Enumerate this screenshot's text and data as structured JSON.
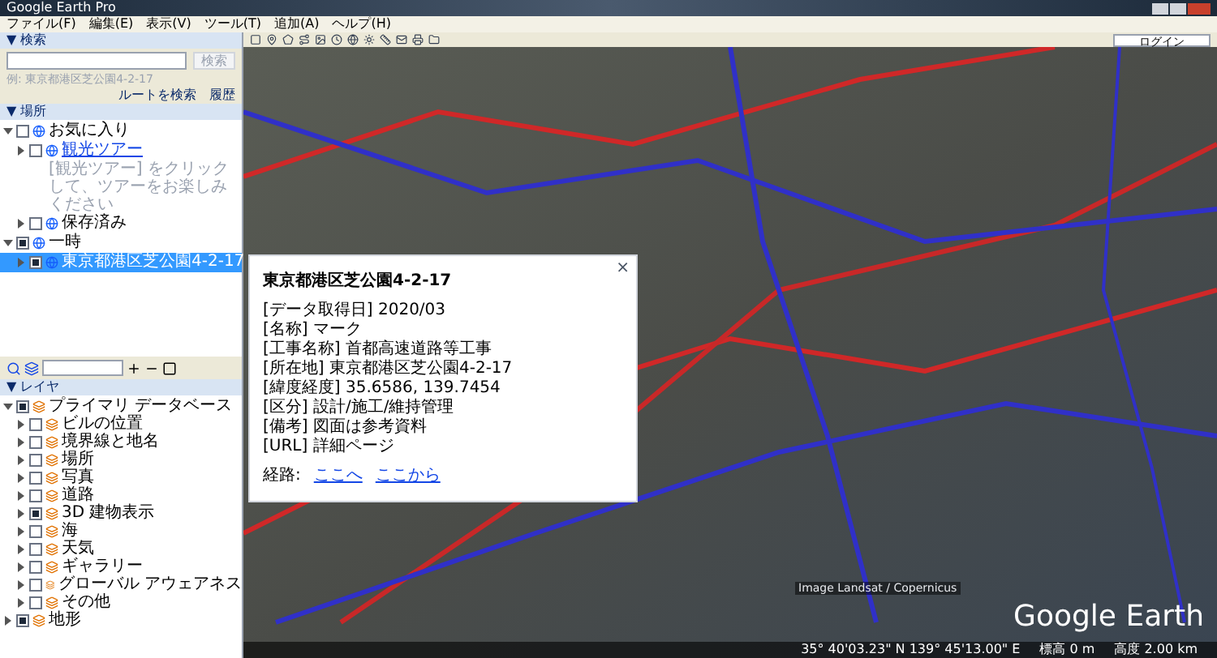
{
  "window": {
    "title": "Google Earth Pro"
  },
  "menu": [
    "ファイル(F)",
    "編集(E)",
    "表示(V)",
    "ツール(T)",
    "追加(A)",
    "ヘルプ(H)"
  ],
  "search": {
    "header": "▼ 検索",
    "button": "検索",
    "hint": "例: 東京都港区芝公園4-2-17",
    "links": [
      "ルートを検索",
      "履歴"
    ]
  },
  "places": {
    "header": "▼ 場所",
    "items": [
      {
        "label": "お気に入り",
        "checked": false,
        "expanded": true,
        "selected": false,
        "children": [
          {
            "label": "観光ツアー",
            "checked": false,
            "expanded": false,
            "selected": false,
            "link": true,
            "description": "[観光ツアー] をクリックして、ツアーをお楽しみください"
          },
          {
            "label": "保存済み",
            "checked": false,
            "expanded": false,
            "selected": false,
            "link": false
          }
        ]
      },
      {
        "label": "一時",
        "checked": true,
        "expanded": true,
        "selected": false,
        "children": [
          {
            "label": "東京都港区芝公園4-2-17",
            "checked": true,
            "expanded": false,
            "selected": true,
            "link": false
          }
        ]
      }
    ]
  },
  "layers": {
    "header": "▼ レイヤ",
    "items": [
      {
        "label": "プライマリ データベース",
        "checked": true,
        "expanded": true,
        "children": [
          {
            "label": "ビルの位置",
            "checked": false,
            "expanded": false
          },
          {
            "label": "境界線と地名",
            "checked": false,
            "expanded": false
          },
          {
            "label": "場所",
            "checked": false,
            "expanded": false
          },
          {
            "label": "写真",
            "checked": false,
            "expanded": false
          },
          {
            "label": "道路",
            "checked": false,
            "expanded": false
          },
          {
            "label": "3D 建物表示",
            "checked": true,
            "expanded": false
          },
          {
            "label": "海",
            "checked": false,
            "expanded": false
          },
          {
            "label": "天気",
            "checked": false,
            "expanded": false
          },
          {
            "label": "ギャラリー",
            "checked": false,
            "expanded": false
          },
          {
            "label": "グローバル アウェアネス",
            "checked": false,
            "expanded": false
          },
          {
            "label": "その他",
            "checked": false,
            "expanded": false
          }
        ]
      },
      {
        "label": "地形",
        "checked": true,
        "expanded": false
      }
    ]
  },
  "login": "ログイン",
  "popup": {
    "close": "×",
    "title": "東京都港区芝公園4-2-17",
    "lines": [
      "[データ取得日] 2020/03",
      "[名称] マーク",
      "[工事名称] 首都高速道路等工事",
      "[所在地] 東京都港区芝公園4-2-17",
      "[緯度経度] 35.6586, 139.7454",
      "[区分] 設計/施工/維持管理",
      "[備考] 図面は参考資料",
      "[URL] 詳細ページ"
    ],
    "links_label": "経路:",
    "links": [
      "ここへ",
      "ここから"
    ]
  },
  "map": {
    "attribution": "Image Landsat / Copernicus",
    "logo": "Google Earth",
    "status": [
      "35° 40'03.23\" N 139° 45'13.00\" E",
      "標高 0 m",
      "高度 2.00 km"
    ]
  }
}
